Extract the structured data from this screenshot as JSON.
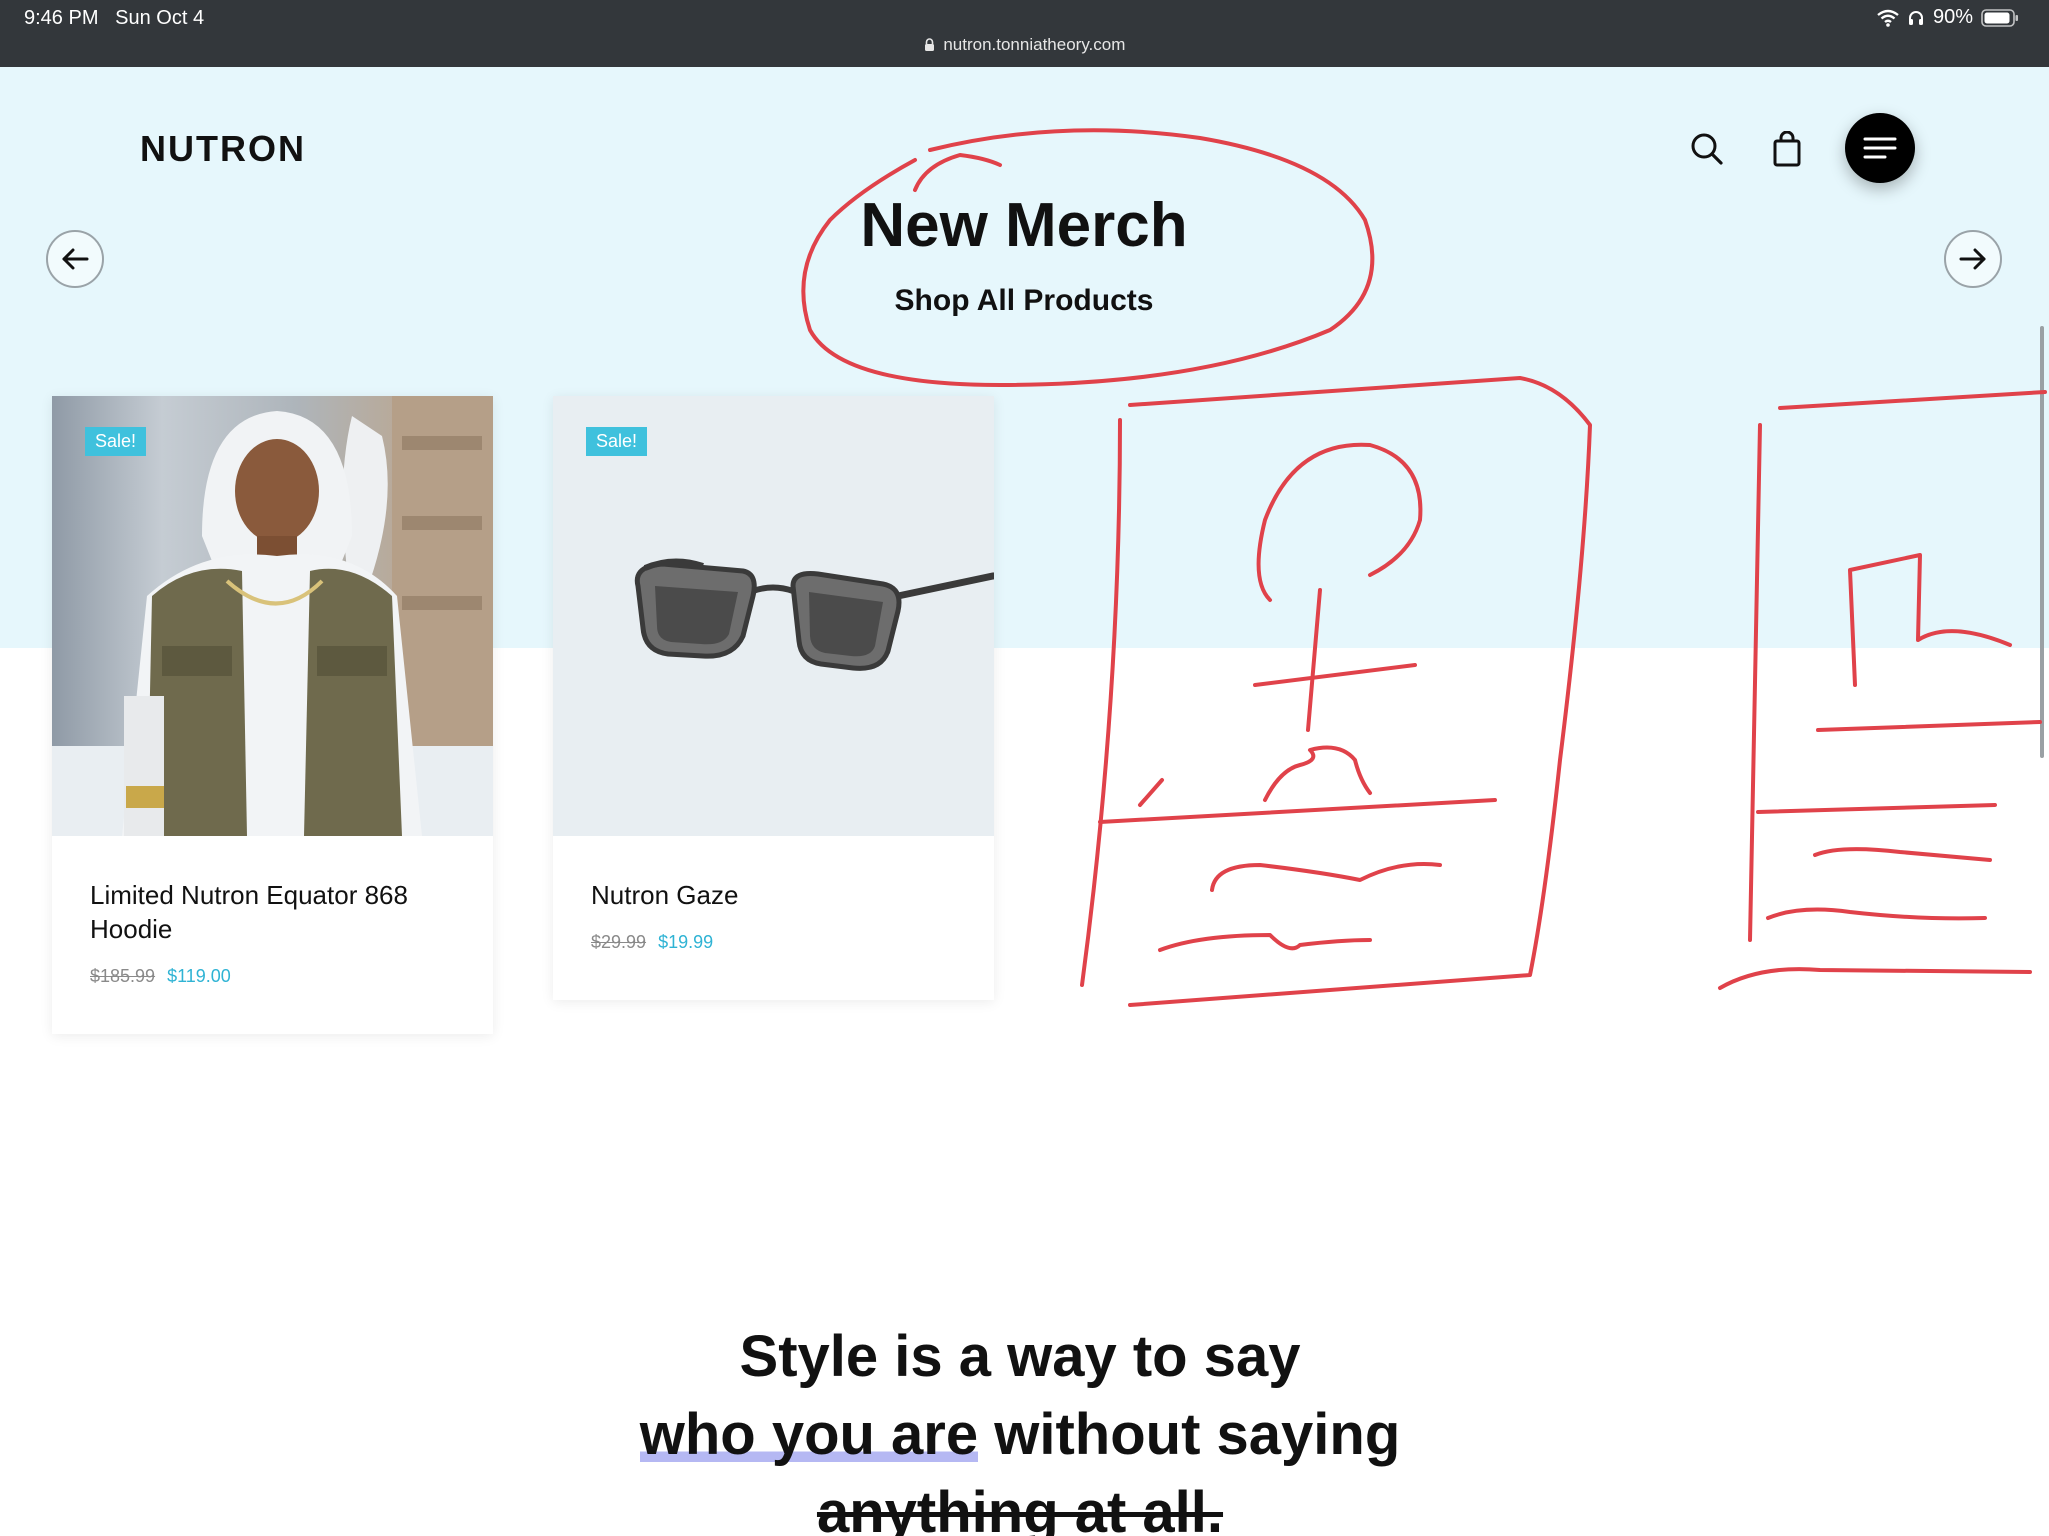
{
  "status_bar": {
    "time": "9:46 PM",
    "date": "Sun Oct 4",
    "battery": "90%",
    "url": "nutron.tonniatheory.com"
  },
  "header": {
    "logo": "NUTRON",
    "icons": [
      "search-icon",
      "shopping-bag-icon",
      "hamburger-menu-icon"
    ]
  },
  "hero": {
    "title": "New Merch",
    "link": "Shop All Products"
  },
  "products": [
    {
      "badge": "Sale!",
      "title": "Limited Nutron Equator 868 Hoodie",
      "old_price": "$185.99",
      "new_price": "$119.00"
    },
    {
      "badge": "Sale!",
      "title": "Nutron Gaze",
      "old_price": "$29.99",
      "new_price": "$19.99"
    }
  ],
  "quote": {
    "line1": "Style is a way to say",
    "line2_highlight": "who you are",
    "line2_rest": " without saying",
    "line3": "anything at all."
  },
  "colors": {
    "hero_bg": "#e6f7fc",
    "accent": "#3fc1dd",
    "annotation": "#e0424a",
    "highlight": "#b5b8f3"
  }
}
